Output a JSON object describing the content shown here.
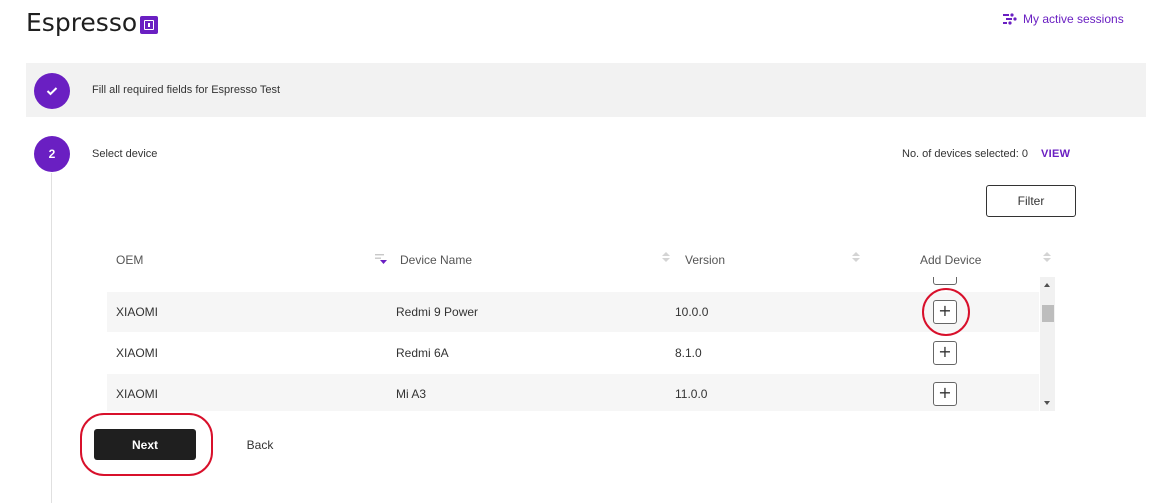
{
  "header": {
    "title": "Espresso",
    "info_icon": "info-icon",
    "sessions_label": "My active sessions",
    "sessions_icon": "sessions-icon"
  },
  "steps": [
    {
      "indicator": "✓",
      "indicator_icon": "check-icon",
      "text": "Fill all required fields for Espresso Test",
      "state": "completed"
    },
    {
      "indicator": "2",
      "text": "Select device",
      "state": "active"
    }
  ],
  "device_selection": {
    "count_label": "No. of devices selected: 0",
    "view_label": "VIEW",
    "filter_label": "Filter"
  },
  "table": {
    "columns": [
      "OEM",
      "Device Name",
      "Version",
      "Add Device"
    ],
    "rows": [
      {
        "oem": "XIAOMI",
        "device": "Redmi 9 Power",
        "version": "10.0.0",
        "add": "+"
      },
      {
        "oem": "XIAOMI",
        "device": "Redmi 6A",
        "version": "8.1.0",
        "add": "+"
      },
      {
        "oem": "XIAOMI",
        "device": "Mi A3",
        "version": "11.0.0",
        "add": "+"
      }
    ]
  },
  "actions": {
    "next_label": "Next",
    "back_label": "Back"
  },
  "colors": {
    "accent": "#6a1fc2",
    "highlight_ring": "#d8102b",
    "primary_button": "#1f1f1f"
  }
}
